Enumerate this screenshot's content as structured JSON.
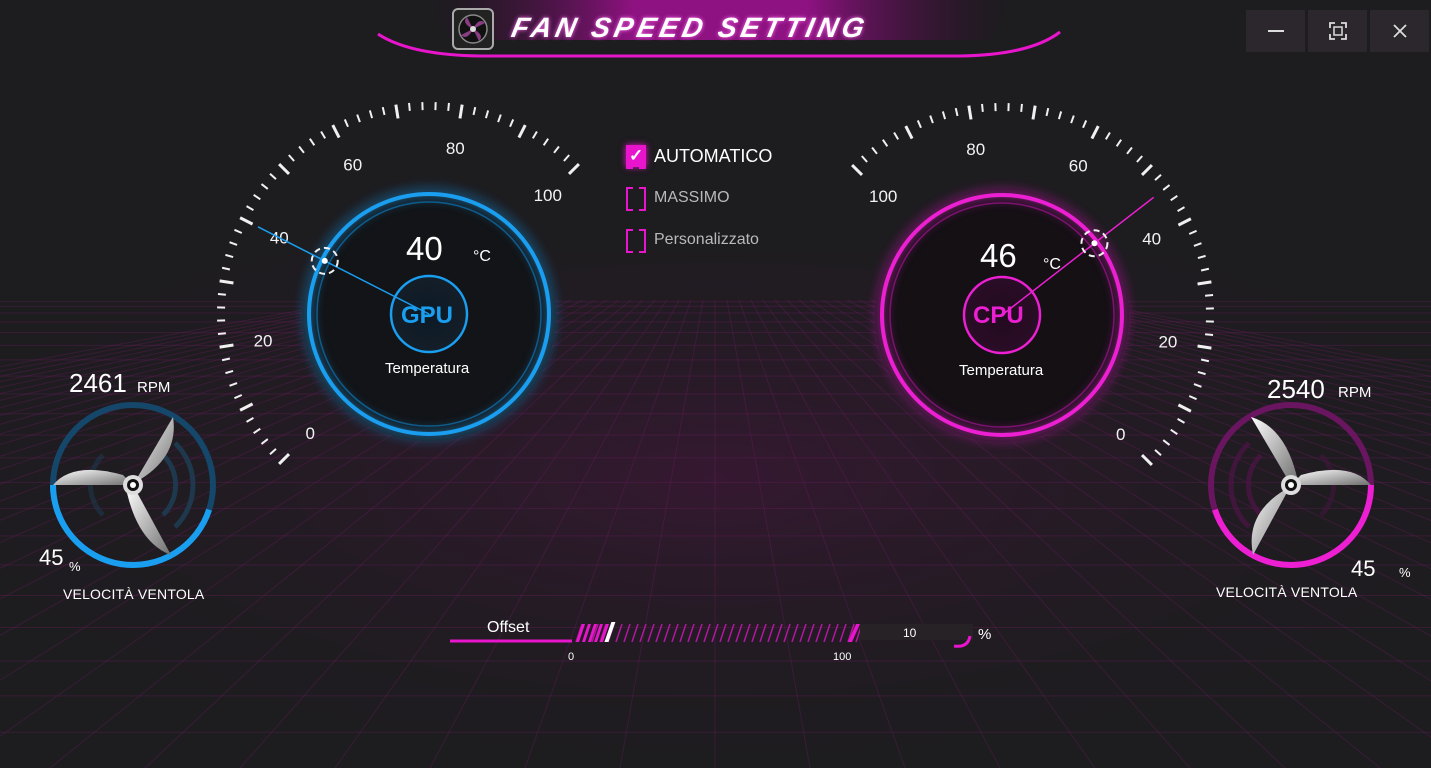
{
  "app": {
    "title": "FAN SPEED SETTING"
  },
  "window_controls": {
    "minimize": "—",
    "maximize": "▢",
    "close": "X"
  },
  "modes": [
    {
      "label": "AUTOMATICO",
      "checked": true
    },
    {
      "label": "MASSIMO",
      "checked": false
    },
    {
      "label": "Personalizzato",
      "checked": false
    }
  ],
  "gpu": {
    "name": "GPU",
    "temperature": "40",
    "temperature_unit": "°C",
    "caption": "Temperatura",
    "scale_labels": [
      "0",
      "20",
      "40",
      "60",
      "80",
      "100"
    ],
    "color": "#1a9ef0"
  },
  "cpu": {
    "name": "CPU",
    "temperature": "46",
    "temperature_unit": "°C",
    "caption": "Temperatura",
    "scale_labels": [
      "0",
      "20",
      "40",
      "60",
      "80",
      "100"
    ],
    "color": "#ec1fd2"
  },
  "fan_left": {
    "rpm": "2461",
    "rpm_unit": "RPM",
    "percent": "45",
    "percent_unit": "%",
    "caption": "VELOCITÀ VENTOLA",
    "fill_fraction": 0.45,
    "color": "#1a9ef0",
    "icon": "propeller-icon"
  },
  "fan_right": {
    "rpm": "2540",
    "rpm_unit": "RPM",
    "percent": "45",
    "percent_unit": "%",
    "caption": "VELOCITÀ VENTOLA",
    "fill_fraction": 0.45,
    "color": "#ec1fd2",
    "icon": "propeller-icon"
  },
  "offset": {
    "label": "Offset",
    "min_label": "0",
    "max_label": "100",
    "value": "10",
    "unit": "%",
    "fraction": 0.1
  },
  "colors": {
    "accent": "#e815cc",
    "gpu": "#1a9ef0",
    "background": "#1d1c1f"
  }
}
